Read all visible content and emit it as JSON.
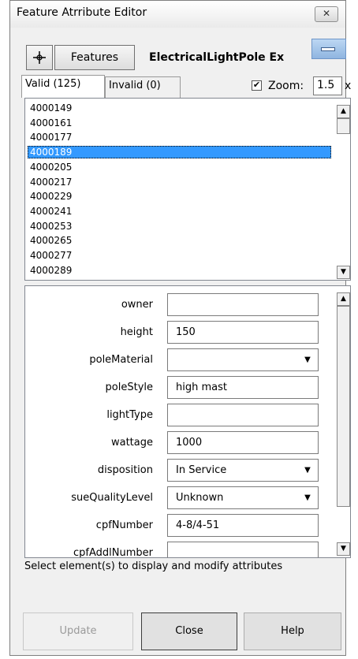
{
  "window": {
    "title": "Feature Atrribute Editor",
    "close_glyph": "✕"
  },
  "toolbar": {
    "features_label": "Features",
    "feature_class": "ElectricalLightPole Ex"
  },
  "tabs": [
    {
      "label": "Valid (125)"
    },
    {
      "label": "Invalid (0)"
    }
  ],
  "zoom": {
    "checked": "✔",
    "label": "Zoom:",
    "value": "1.5",
    "unit": "x"
  },
  "list": {
    "items": [
      "4000149",
      "4000161",
      "4000177",
      "4000189",
      "4000205",
      "4000217",
      "4000229",
      "4000241",
      "4000253",
      "4000265",
      "4000277",
      "4000289"
    ],
    "selected": "4000189"
  },
  "attributes": [
    {
      "label": "owner",
      "value": "",
      "dropdown": false
    },
    {
      "label": "height",
      "value": "150",
      "dropdown": false
    },
    {
      "label": "poleMaterial",
      "value": "",
      "dropdown": true
    },
    {
      "label": "poleStyle",
      "value": "high mast",
      "dropdown": false
    },
    {
      "label": "lightType",
      "value": "",
      "dropdown": false
    },
    {
      "label": "wattage",
      "value": "1000",
      "dropdown": false
    },
    {
      "label": "disposition",
      "value": "In Service",
      "dropdown": true
    },
    {
      "label": "sueQualityLevel",
      "value": "Unknown",
      "dropdown": true
    },
    {
      "label": "cpfNumber",
      "value": "4-8/4-51",
      "dropdown": false
    },
    {
      "label": "cpfAddlNumber",
      "value": "",
      "dropdown": false
    }
  ],
  "status": "Select element(s) to display and modify attributes",
  "buttons": {
    "update": "Update",
    "close": "Close",
    "help": "Help"
  },
  "colors": {
    "selection": "#3399ff",
    "minimize_button": "#a8c8ec"
  }
}
